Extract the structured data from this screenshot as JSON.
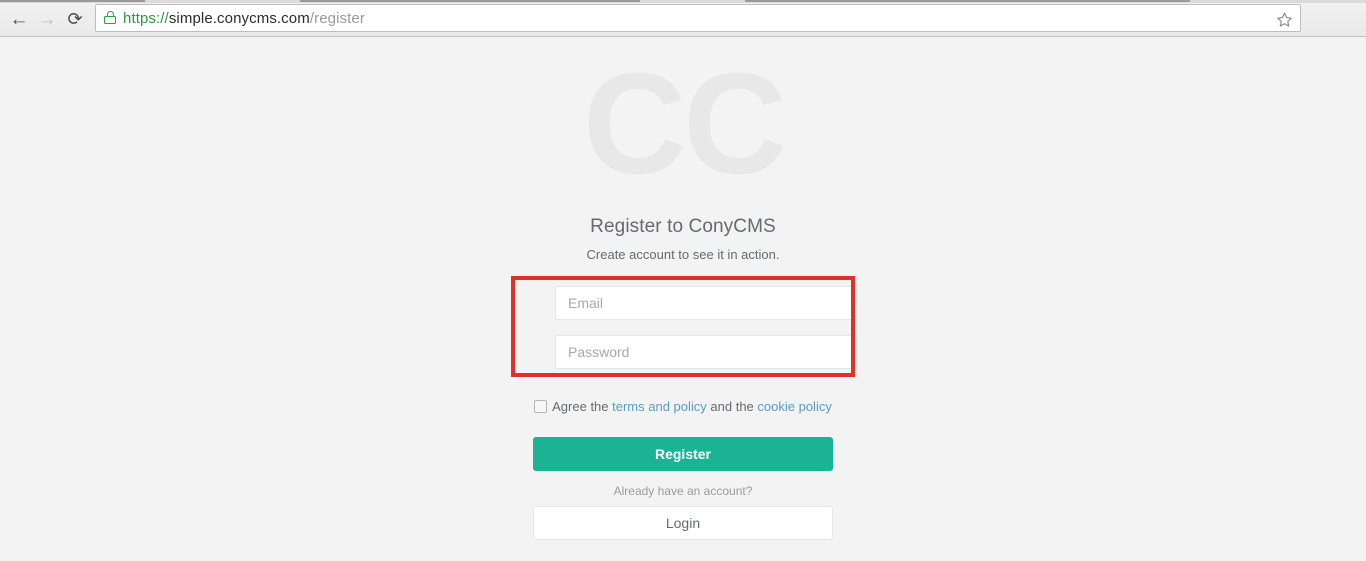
{
  "browser": {
    "back_label": "←",
    "forward_label": "→",
    "reload_label": "⟳",
    "back_icon": "back-arrow-icon",
    "forward_icon": "forward-arrow-icon",
    "reload_icon": "reload-icon",
    "lock_icon": "padlock-icon",
    "bookmark_icon": "star-icon",
    "url": {
      "full": "https://simple.conycms.com/register",
      "scheme": "https://",
      "host": "simple.conycms.com",
      "path": "/register"
    }
  },
  "page": {
    "brand_logo_text": "CC",
    "title": "Register to ConyCMS",
    "subtitle": "Create account to see it in action.",
    "form": {
      "email_placeholder": "Email",
      "email_value": "",
      "password_placeholder": "Password",
      "password_value": ""
    },
    "agreement": {
      "prefix": "Agree the ",
      "terms_link": "terms and policy",
      "middle": " and the ",
      "cookie_link": "cookie policy",
      "checked": false
    },
    "register_button_label": "Register",
    "login_prompt": "Already have an account?",
    "login_button_label": "Login"
  },
  "colors": {
    "page_background": "#f3f3f4",
    "brand_accent": "#1ab394",
    "highlight_red": "#e0302c",
    "link_blue": "#5a9bc4",
    "text_gray": "#676a6c",
    "logo_gray": "#e8e8e8",
    "url_scheme_green": "#2a9a3d"
  },
  "annotation": {
    "highlight_target": "email-and-password-fields"
  }
}
